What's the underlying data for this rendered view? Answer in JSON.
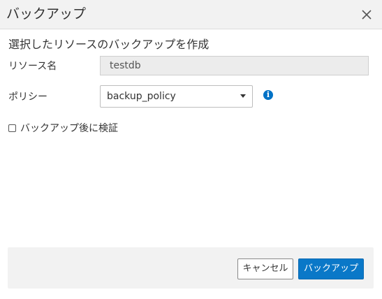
{
  "dialog": {
    "title": "バックアップ",
    "close_icon": "close-icon"
  },
  "form": {
    "heading": "選択したリソースのバックアップを作成",
    "resource_name": {
      "label": "リソース名",
      "value": "testdb"
    },
    "policy": {
      "label": "ポリシー",
      "selected": "backup_policy",
      "info_icon": "info-icon"
    },
    "verify_after_backup": {
      "label": "バックアップ後に検証",
      "checked": false
    }
  },
  "footer": {
    "cancel_label": "キャンセル",
    "backup_label": "バックアップ"
  },
  "colors": {
    "primary_button": "#0a78c8",
    "info_icon": "#0072c6",
    "titlebar_bg": "#f2f2f2"
  }
}
